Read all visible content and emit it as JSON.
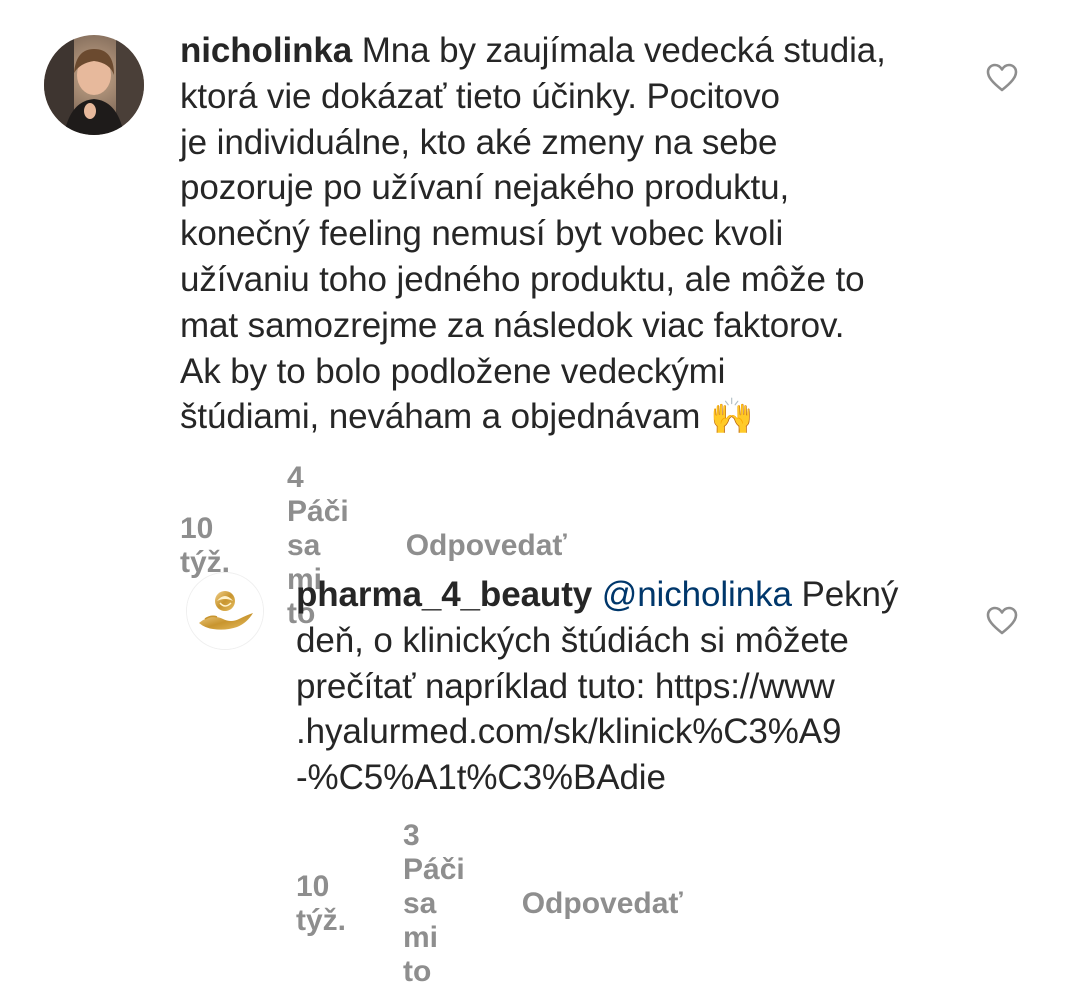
{
  "comments": [
    {
      "username": "nicholinka",
      "text": "Mna by zaujímala vedecká studia,\nktorá vie dokázať tieto účinky. Pocitovo\nje individuálne, kto aké zmeny na sebe\npozoruje po užívaní nejakého produktu,\nkonečný feeling nemusí byt vobec kvoli\nužívaniu toho jedného produktu, ale môže to\nmat samozrejme za následok viac faktorov.\nAk by to bolo podložene vedeckými\nštúdiami, neváham a objednávam 🙌",
      "time": "10 týž.",
      "likes": "4 Páči sa mi to",
      "reply": "Odpovedať",
      "avatar_icon": "profile-photo"
    },
    {
      "username": "pharma_4_beauty",
      "mention": "@nicholinka",
      "text": "Pekný\ndeň, o klinických štúdiách si môžete\nprečítať napríklad tuto: https://www\n.hyalurmed.com/sk/klinick%C3%A9\n-%C5%A1t%C3%BAdie",
      "time": "10 týž.",
      "likes": "3 Páči sa mi to",
      "reply": "Odpovedať",
      "avatar_icon": "gold-rose-hands-logo"
    }
  ],
  "icons": {
    "like": "heart-outline-icon"
  },
  "colors": {
    "text": "#262626",
    "meta": "#8e8e8e",
    "mention": "#00376b",
    "heart_stroke": "#8e8e8e",
    "logo_gold": "#d4a84a"
  }
}
